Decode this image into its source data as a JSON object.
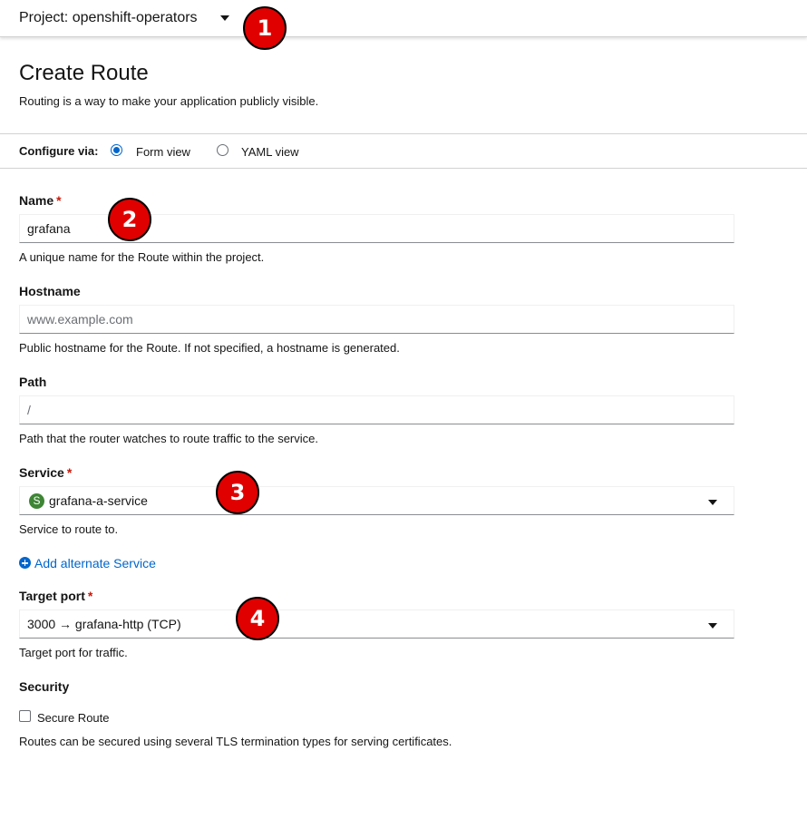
{
  "header": {
    "project_label": "Project: openshift-operators"
  },
  "page": {
    "title": "Create Route",
    "description": "Routing is a way to make your application publicly visible."
  },
  "configure": {
    "label": "Configure via:",
    "options": [
      {
        "label": "Form view",
        "selected": true
      },
      {
        "label": "YAML view",
        "selected": false
      }
    ]
  },
  "form": {
    "name": {
      "label": "Name",
      "required_mark": "*",
      "value": "grafana",
      "helper": "A unique name for the Route within the project."
    },
    "hostname": {
      "label": "Hostname",
      "placeholder": "www.example.com",
      "helper": "Public hostname for the Route. If not specified, a hostname is generated."
    },
    "path": {
      "label": "Path",
      "placeholder": "/",
      "helper": "Path that the router watches to route traffic to the service."
    },
    "service": {
      "label": "Service",
      "required_mark": "*",
      "badge": "S",
      "value": "grafana-a-service",
      "helper": "Service to route to."
    },
    "add_alternate_service": "Add alternate Service",
    "target_port": {
      "label": "Target port",
      "required_mark": "*",
      "value": "3000 → grafana-http (TCP)",
      "helper": "Target port for traffic."
    },
    "security": {
      "title": "Security",
      "secure_route_label": "Secure Route",
      "secure_route_checked": false,
      "helper": "Routes can be secured using several TLS termination types for serving certificates."
    }
  },
  "annotations": [
    "1",
    "2",
    "3",
    "4"
  ],
  "colors": {
    "link": "#0066cc",
    "required": "#c9190b",
    "service_badge": "#3e8635",
    "annotation": "#e00000"
  }
}
